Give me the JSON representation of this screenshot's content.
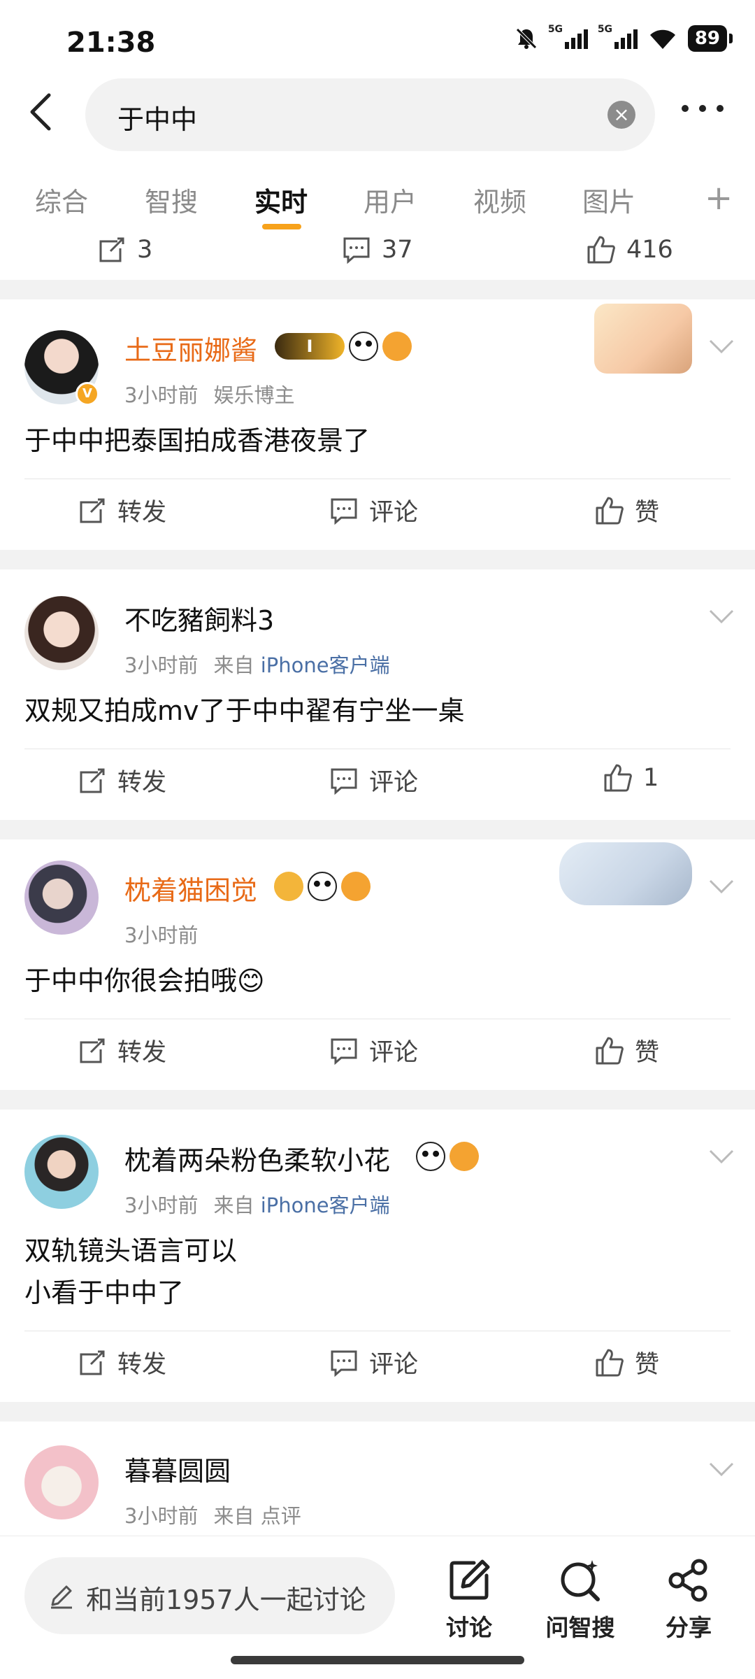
{
  "status": {
    "time": "21:38",
    "battery": "89",
    "net1": "5G",
    "net2": "5G"
  },
  "search": {
    "query": "于中中",
    "clear": "×"
  },
  "tabs": [
    "综合",
    "智搜",
    "实时",
    "用户",
    "视频",
    "图片"
  ],
  "tab_plus": "+",
  "prev_post": {
    "reposts": "3",
    "comments": "37",
    "likes": "416"
  },
  "posts": [
    {
      "name": "土豆丽娜酱",
      "time": "3小时前",
      "source": "娱乐博主",
      "text": "于中中把泰国拍成香港夜景了",
      "vip_level": "I",
      "repost": "转发",
      "comment": "评论",
      "like": "赞"
    },
    {
      "name": "不吃豬飼料3",
      "time": "3小时前",
      "source_prefix": "来自",
      "source": "iPhone客户端",
      "text": "双规又拍成mv了于中中翟有宁坐一桌",
      "repost": "转发",
      "comment": "评论",
      "like": "1"
    },
    {
      "name": "枕着猫困觉",
      "time": "3小时前",
      "text": "于中中你很会拍哦😊",
      "repost": "转发",
      "comment": "评论",
      "like": "赞"
    },
    {
      "name": "枕着两朵粉色柔软小花",
      "time": "3小时前",
      "source_prefix": "来自",
      "source": "iPhone客户端",
      "text_lines": [
        "双轨镜头语言可以",
        "小看于中中了"
      ],
      "repost": "转发",
      "comment": "评论",
      "like": "赞"
    },
    {
      "name": "暮暮圆圆",
      "time": "3小时前",
      "source_prefix": "来自",
      "source": "点评"
    }
  ],
  "bottom": {
    "discuss_placeholder": "和当前1957人一起讨论",
    "btn_discuss": "讨论",
    "btn_ask": "问智搜",
    "btn_share": "分享"
  },
  "colors": {
    "accent": "#f7a21b",
    "vip_name": "#e86a17",
    "link": "#4a6fa5"
  },
  "icons": [
    "back-icon",
    "clear-icon",
    "more-icon",
    "repost-icon",
    "comment-icon",
    "like-icon",
    "pencil-icon",
    "edit-icon",
    "ask-icon",
    "share-icon",
    "chevron-down-icon"
  ]
}
